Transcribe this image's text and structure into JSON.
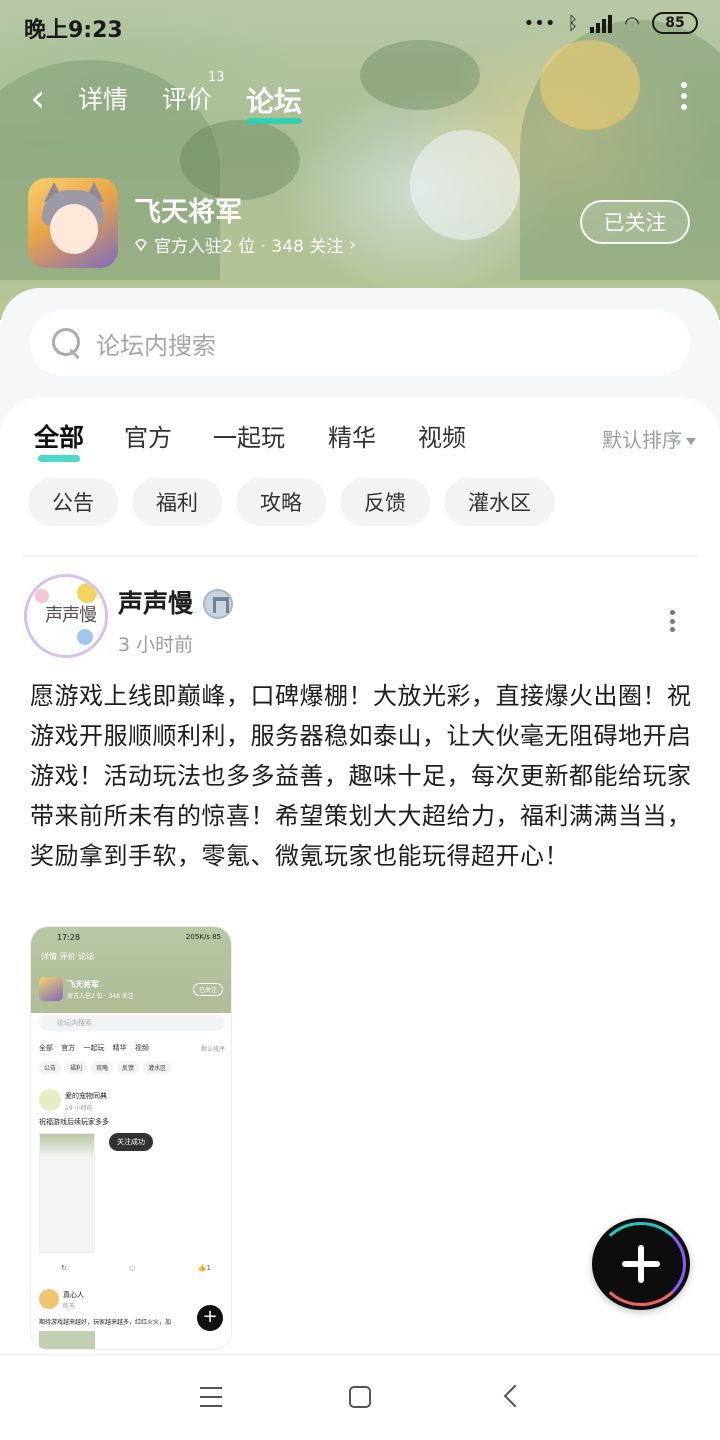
{
  "status_bar": {
    "time": "晚上9:23",
    "battery": "85",
    "icons": [
      "dots-icon",
      "bluetooth-icon",
      "hd-signal-icon",
      "wifi-icon",
      "battery-icon"
    ]
  },
  "nav": {
    "tabs": [
      {
        "label": "详情"
      },
      {
        "label": "评价",
        "count": "13"
      },
      {
        "label": "论坛",
        "active": true
      }
    ]
  },
  "game": {
    "title": "飞天将军",
    "meta": "官方入驻2 位 · 348 关注",
    "follow_label": "已关注"
  },
  "search": {
    "placeholder": "论坛内搜索"
  },
  "tabs": [
    {
      "label": "全部",
      "active": true
    },
    {
      "label": "官方"
    },
    {
      "label": "一起玩"
    },
    {
      "label": "精华"
    },
    {
      "label": "视频"
    }
  ],
  "sort_label": "默认排序",
  "chips": [
    "公告",
    "福利",
    "攻略",
    "反馈",
    "灌水区"
  ],
  "post": {
    "author": "声声慢",
    "avatar_text": "声声慢",
    "time": "3 小时前",
    "text": "愿游戏上线即巅峰，口碑爆棚！大放光彩，直接爆火出圈！祝游戏开服顺顺利利，服务器稳如泰山，让大伙毫无阻碍地开启游戏！活动玩法也多多益善，趣味十足，每次更新都能给玩家带来前所未有的惊喜！希望策划大大超给力，福利满满当当，奖励拿到手软，零氪、微氪玩家也能玩得超开心！",
    "screenshot": {
      "time": "17:28",
      "net": "205K/s 85",
      "nav": "详情 评价 论坛",
      "title": "飞天将军",
      "meta": "官方入驻2 位 · 348 关注",
      "follow": "已关注",
      "search": "论坛内搜索",
      "tabs": "全部 官方 一起玩 精华 视频",
      "sort": "默认排序",
      "chips": [
        "公告",
        "福利",
        "攻略",
        "反馈",
        "灌水区"
      ],
      "post1_name": "爱的宠物同典",
      "post1_time": "19 小时前",
      "post1_text": "祝福游戏后续玩家多多",
      "toast": "关注成功",
      "likes": "1",
      "post2_name": "真心人",
      "post2_time": "昨天",
      "post2_text": "期待游戏越来越好，玩家越来越多，红红火火，加"
    }
  },
  "colors": {
    "accent": "#1fd0b6",
    "fab_bg": "#0d0d0d",
    "tab_text": "#333333"
  }
}
